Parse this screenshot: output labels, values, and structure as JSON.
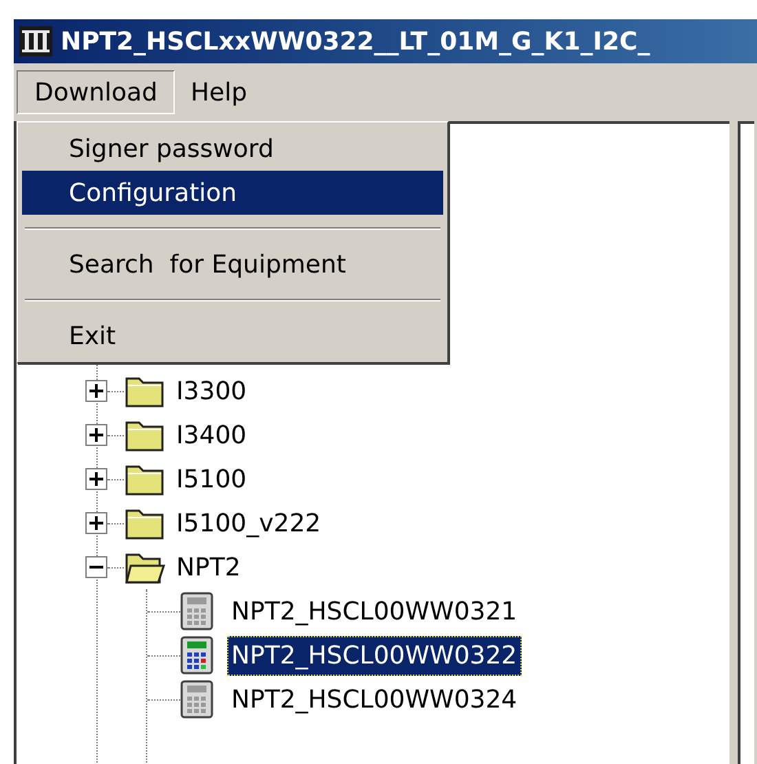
{
  "window": {
    "title": "NPT2_HSCLxxWW0322__LT_01M_G_K1_I2C_"
  },
  "menu_bar": [
    {
      "label": "Download",
      "selected": true
    },
    {
      "label": "Help",
      "selected": false
    }
  ],
  "menu": [
    {
      "kind": "item",
      "label": "Signer password",
      "selected": false
    },
    {
      "kind": "item",
      "label": "Configuration",
      "selected": true
    },
    {
      "kind": "separator"
    },
    {
      "kind": "item",
      "label": "Search  for Equipment",
      "selected": false
    },
    {
      "kind": "separator"
    },
    {
      "kind": "item",
      "label": "Exit",
      "selected": false
    }
  ],
  "tree": [
    {
      "label": "I3300",
      "expanded": false
    },
    {
      "label": "I3400",
      "expanded": false
    },
    {
      "label": "I5100",
      "expanded": false
    },
    {
      "label": "I5100_v222",
      "expanded": false
    },
    {
      "label": "NPT2",
      "expanded": true,
      "children": [
        {
          "label": "NPT2_HSCL00WW0321",
          "selected": false
        },
        {
          "label": "NPT2_HSCL00WW0322",
          "selected": true
        },
        {
          "label": "NPT2_HSCL00WW0324",
          "selected": false
        }
      ]
    }
  ]
}
